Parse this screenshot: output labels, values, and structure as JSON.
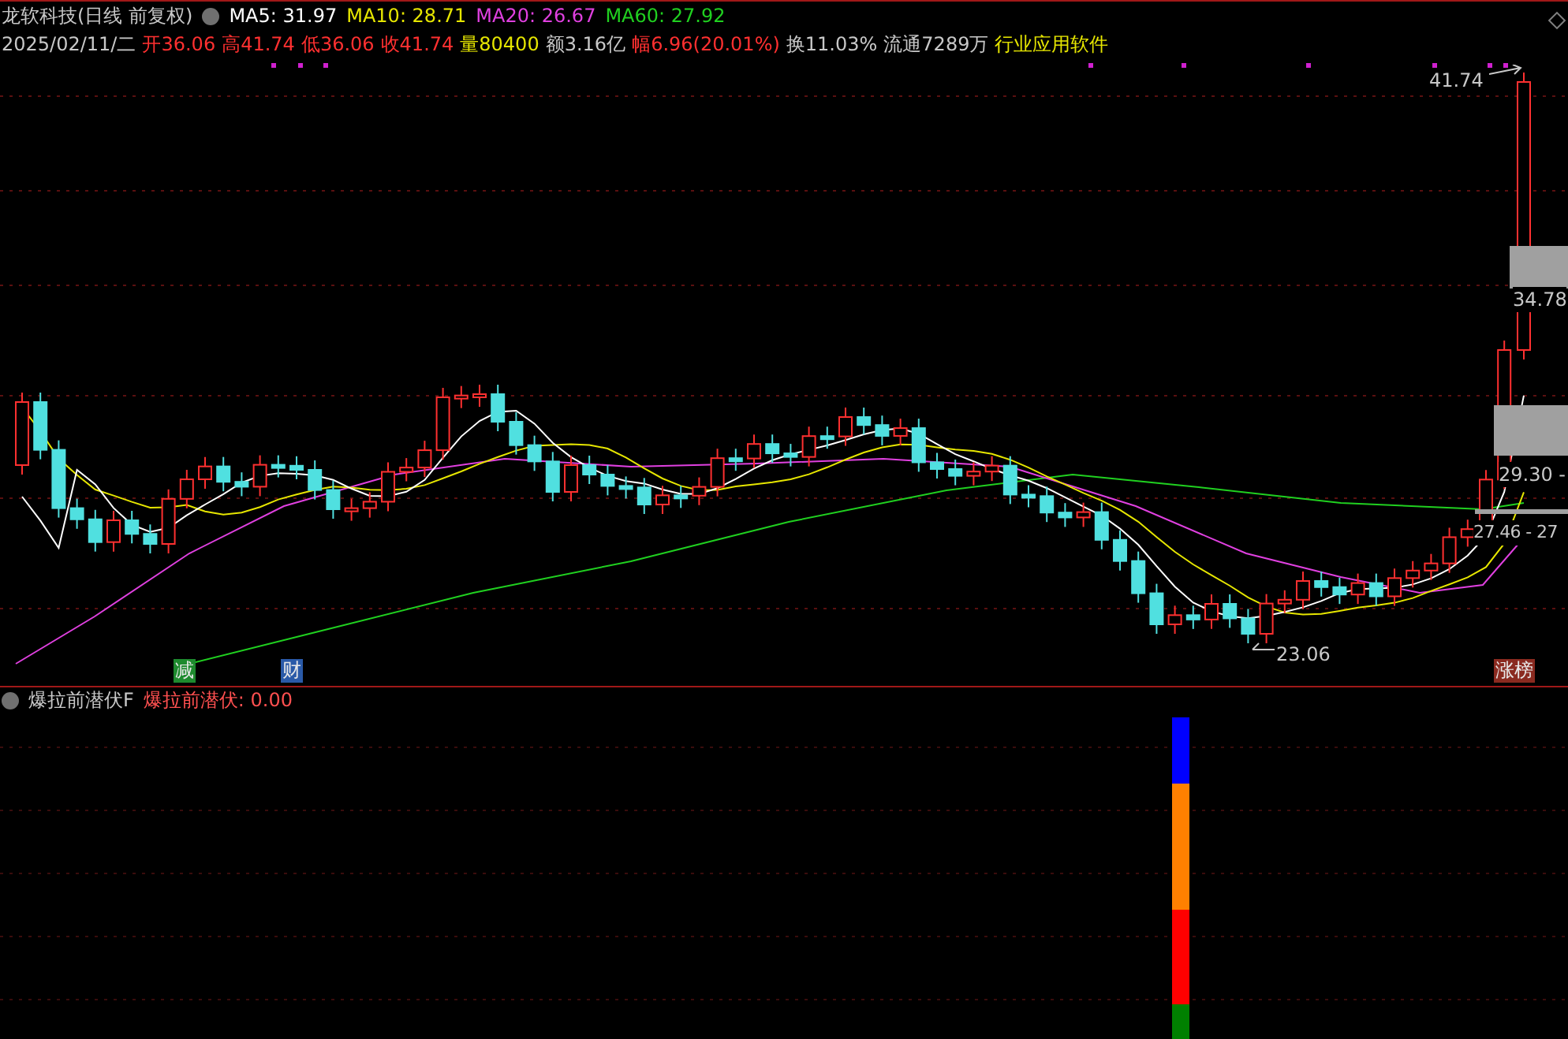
{
  "stock": {
    "name": "龙软科技(日线 前复权)"
  },
  "ma_legend": [
    {
      "text": "MA5: 31.97",
      "color": "#ffffff"
    },
    {
      "text": "MA10: 28.71",
      "color": "#e6e600"
    },
    {
      "text": "MA20: 26.67",
      "color": "#e040e0"
    },
    {
      "text": "MA60: 27.92",
      "color": "#20d020"
    }
  ],
  "quote": [
    {
      "text": "2025/02/11/二",
      "color": "#c8c8c8"
    },
    {
      "text": "开36.06",
      "color": "#ff3030"
    },
    {
      "text": "高41.74",
      "color": "#ff3030"
    },
    {
      "text": "低36.06",
      "color": "#ff3030"
    },
    {
      "text": "收41.74",
      "color": "#ff3030"
    },
    {
      "text": "量80400",
      "color": "#e6e600"
    },
    {
      "text": "额3.16亿",
      "color": "#c8c8c8"
    },
    {
      "text": "幅6.96(20.01%)",
      "color": "#ff3030"
    },
    {
      "text": "换11.03%",
      "color": "#c8c8c8"
    },
    {
      "text": "流通7289万",
      "color": "#c8c8c8"
    },
    {
      "text": "行业应用软件",
      "color": "#e6e600"
    }
  ],
  "chart_labels": {
    "high": "41.74",
    "level_1": "34.78",
    "level_2": "29.30 -",
    "level_3": "27.46 - 27",
    "low": "23.06"
  },
  "event_tags": [
    {
      "text": "减",
      "color": "#1e8a2e"
    },
    {
      "text": "财",
      "color": "#2a5aa8"
    },
    {
      "text": "涨榜",
      "color": "#8a2a20"
    }
  ],
  "indicator": {
    "title": "爆拉前潜伏F",
    "value": "爆拉前潜伏: 0.00",
    "segments": [
      {
        "color": "#0000ff"
      },
      {
        "color": "#ff8000"
      },
      {
        "color": "#ff0000"
      },
      {
        "color": "#008000"
      }
    ]
  }
}
